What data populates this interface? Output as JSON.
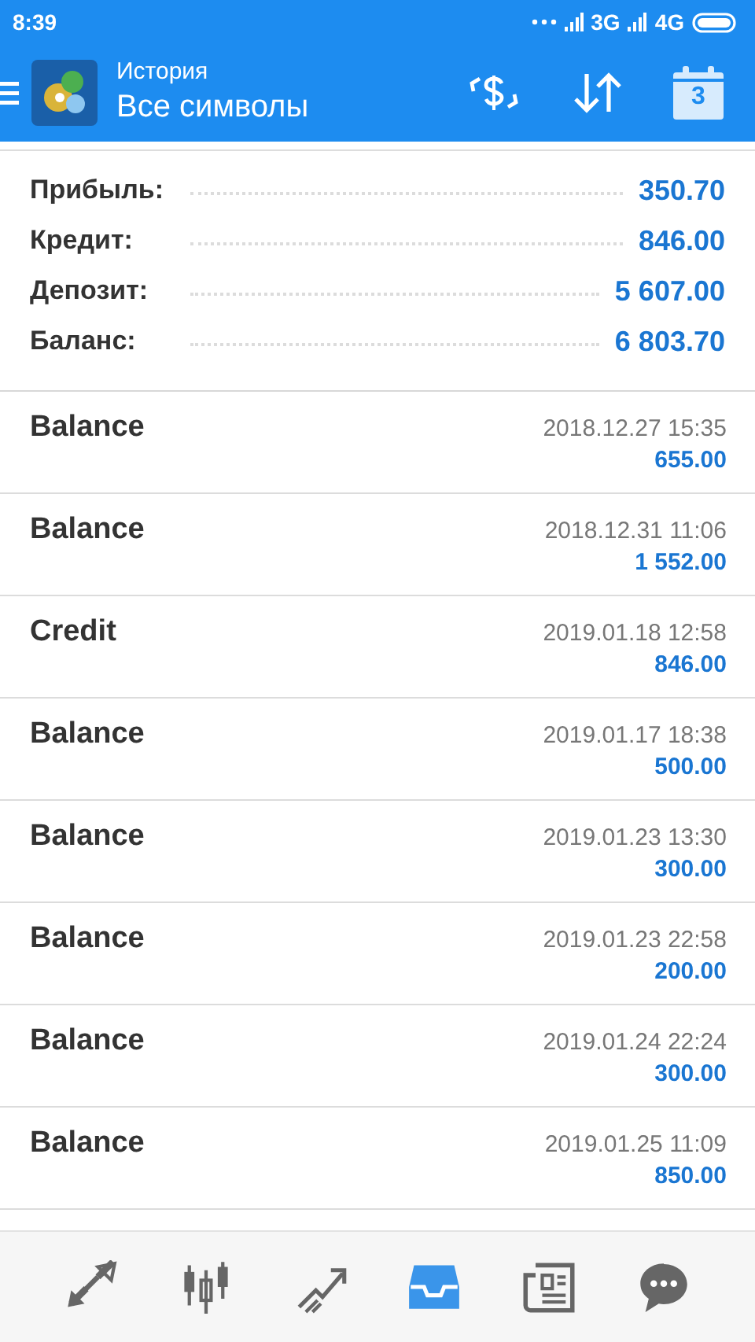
{
  "status_bar": {
    "time": "8:39",
    "network_1": "3G",
    "network_2": "4G"
  },
  "header": {
    "title": "История",
    "subtitle": "Все символы",
    "calendar_day": "3"
  },
  "summary": [
    {
      "label": "Прибыль:",
      "value": "350.70"
    },
    {
      "label": "Кредит:",
      "value": "846.00"
    },
    {
      "label": "Депозит:",
      "value": "5 607.00"
    },
    {
      "label": "Баланс:",
      "value": "6 803.70"
    }
  ],
  "deals": [
    {
      "type": "Balance",
      "time": "2018.12.27 15:35",
      "amount": "655.00"
    },
    {
      "type": "Balance",
      "time": "2018.12.31 11:06",
      "amount": "1 552.00"
    },
    {
      "type": "Credit",
      "time": "2019.01.18 12:58",
      "amount": "846.00"
    },
    {
      "type": "Balance",
      "time": "2019.01.17 18:38",
      "amount": "500.00"
    },
    {
      "type": "Balance",
      "time": "2019.01.23 13:30",
      "amount": "300.00"
    },
    {
      "type": "Balance",
      "time": "2019.01.23 22:58",
      "amount": "200.00"
    },
    {
      "type": "Balance",
      "time": "2019.01.24 22:24",
      "amount": "300.00"
    },
    {
      "type": "Balance",
      "time": "2019.01.25 11:09",
      "amount": "850.00"
    }
  ],
  "bottom_nav": [
    {
      "kind": "quotes",
      "selected": false
    },
    {
      "kind": "chart",
      "selected": false
    },
    {
      "kind": "trade",
      "selected": false
    },
    {
      "kind": "history",
      "selected": true
    },
    {
      "kind": "news",
      "selected": false
    },
    {
      "kind": "chat",
      "selected": false
    }
  ]
}
